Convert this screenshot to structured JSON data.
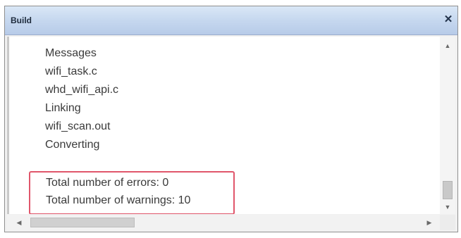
{
  "panel": {
    "title": "Build",
    "close_symbol": "✕",
    "close_icon": "close-icon"
  },
  "output": {
    "lines": [
      "Messages",
      "wifi_task.c",
      "whd_wifi_api.c",
      "Linking",
      "wifi_scan.out",
      "Converting"
    ],
    "summary": {
      "errors": "Total number of errors: 0",
      "warnings": "Total number of warnings: 10"
    }
  },
  "scrollbars": {
    "up_arrow": "▲",
    "down_arrow": "▼",
    "left_arrow": "◀",
    "right_arrow": "▶"
  },
  "colors": {
    "title_bar": "#c4d6ee",
    "highlight": "#e0566b"
  }
}
